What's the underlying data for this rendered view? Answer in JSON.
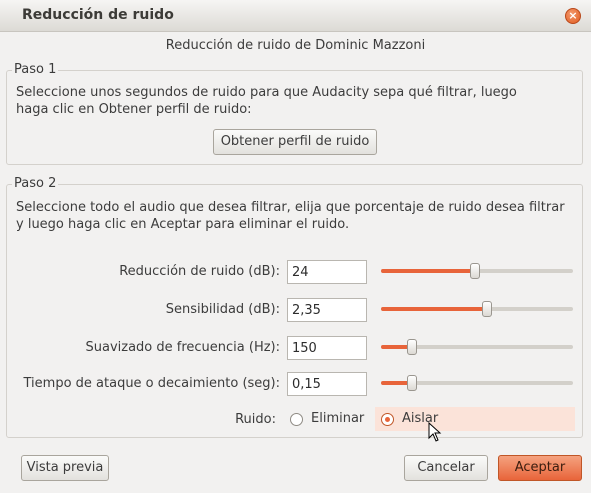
{
  "window": {
    "title": "Reducción de ruido",
    "close_glyph": "×"
  },
  "header": "Reducción de ruido de Dominic Mazzoni",
  "step1": {
    "label": "Paso 1",
    "line1": "Seleccione unos segundos de ruido para que Audacity sepa qué filtrar, luego",
    "line2": "haga clic en Obtener perfil de ruido:",
    "button": "Obtener perfil de ruido"
  },
  "step2": {
    "label": "Paso 2",
    "line1": "Seleccione todo el audio que desea filtrar, elija que porcentaje de ruido desea filtrar",
    "line2": "y luego haga clic en Aceptar para eliminar el ruido.",
    "params": [
      {
        "label": "Reducción de ruido (dB):",
        "value": "24",
        "slider": 0.49
      },
      {
        "label": "Sensibilidad (dB):",
        "value": "2,35",
        "slider": 0.55
      },
      {
        "label": "Suavizado de frecuencia (Hz):",
        "value": "150",
        "slider": 0.16
      },
      {
        "label": "Tiempo de ataque o decaimiento (seg):",
        "value": "0,15",
        "slider": 0.16
      }
    ],
    "noise_label": "Ruido:",
    "options": [
      {
        "label": "Eliminar",
        "selected": false
      },
      {
        "label": "Aislar",
        "selected": true
      }
    ]
  },
  "footer": {
    "preview": "Vista previa",
    "cancel": "Cancelar",
    "ok": "Aceptar"
  },
  "colors": {
    "accent": "#e8643a",
    "background": "#f2f1f0",
    "selection_highlight": "#fbe3d9"
  },
  "icons": {
    "close": "close-icon",
    "cursor": "mouse-pointer-icon"
  }
}
